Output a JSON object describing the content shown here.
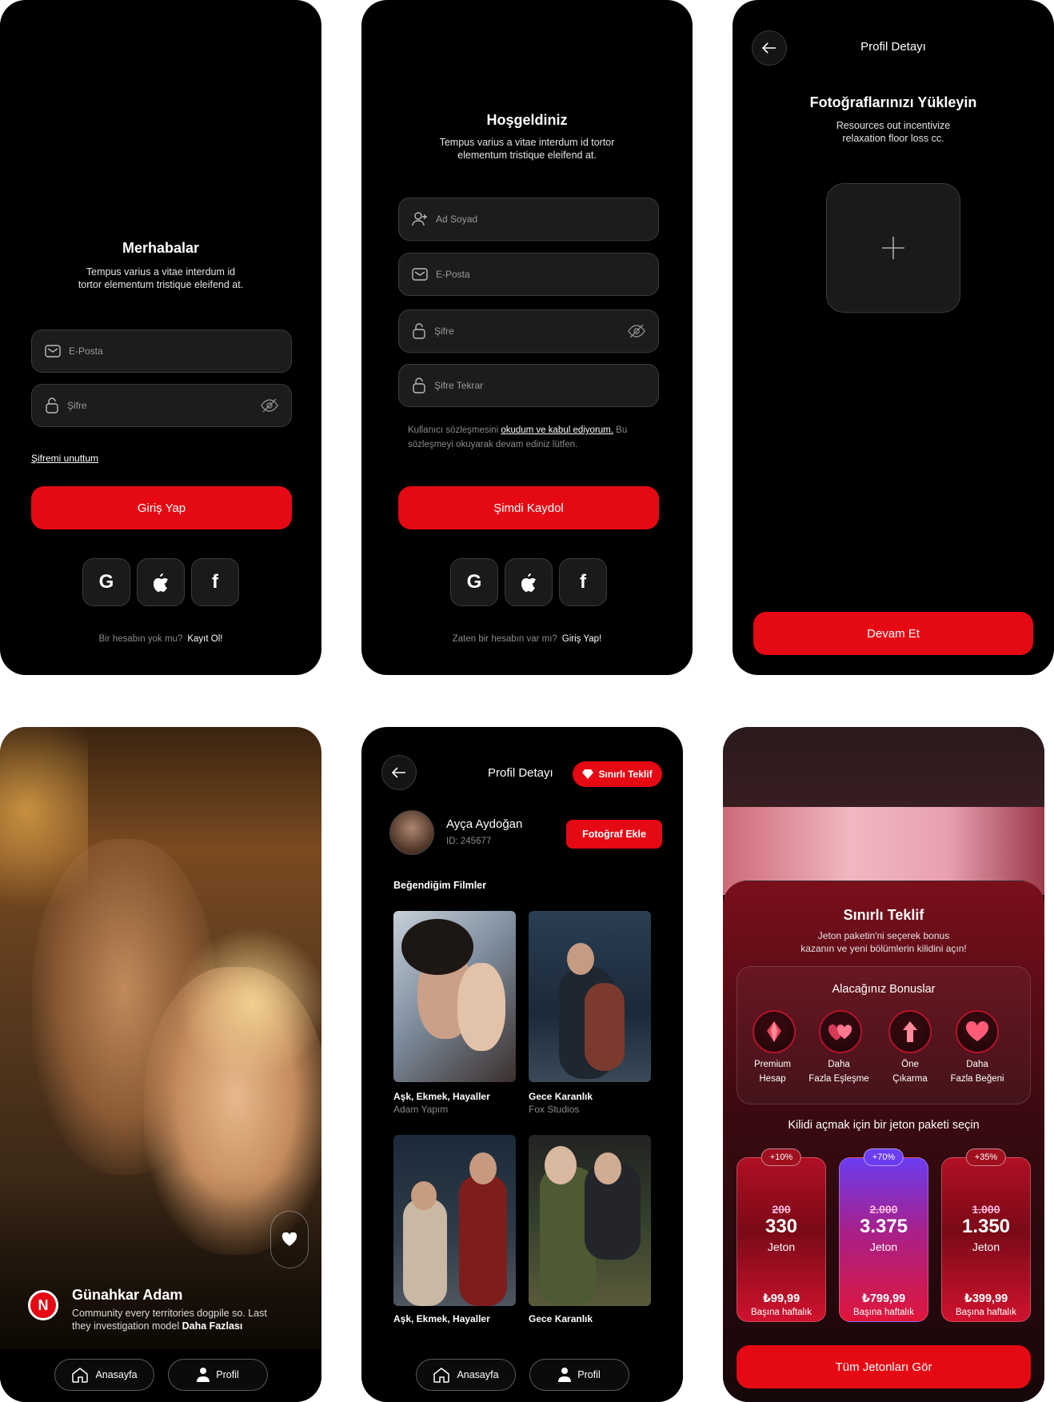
{
  "login": {
    "title": "Merhabalar",
    "subtitle_1": "Tempus varius a vitae interdum id",
    "subtitle_2": "tortor elementum tristique eleifend at.",
    "email_placeholder": "E-Posta",
    "password_placeholder": "Şifre",
    "forgot": "Şifremi unuttum",
    "submit": "Giriş Yap",
    "no_account": "Bir hesabın yok mu?",
    "signup_link": "Kayıt Ol!"
  },
  "register": {
    "title": "Hoşgeldiniz",
    "subtitle_1": "Tempus varius a vitae interdum id tortor",
    "subtitle_2": "elementum tristique eleifend at.",
    "name_placeholder": "Ad Soyad",
    "email_placeholder": "E-Posta",
    "password_placeholder": "Şifre",
    "password_repeat_placeholder": "Şifre Tekrar",
    "terms_pre": "Kullanıcı sözleşmesini ",
    "terms_link": "okudum ve kabul ediyorum.",
    "terms_post": " Bu",
    "terms_line2": "sözleşmeyi okuyarak devam ediniz lütfen.",
    "submit": "Şimdi Kaydol",
    "have_account": "Zaten bir hesabın var mı?",
    "login_link": "Giriş Yap!"
  },
  "upload": {
    "header": "Profil Detayı",
    "title": "Fotoğraflarınızı Yükleyin",
    "subtitle_1": "Resources out incentivize",
    "subtitle_2": "relaxation floor loss cc.",
    "continue": "Devam Et"
  },
  "feed": {
    "logo_letter": "N",
    "movie_title": "Günahkar Adam",
    "desc_1": "Community every territories dogpile so. Last",
    "desc_2": "they investigation model",
    "more": "Daha Fazlası",
    "nav_home": "Anasayfa",
    "nav_profile": "Profil"
  },
  "profile": {
    "header": "Profil Detayı",
    "offer_badge": "Sınırlı Teklif",
    "name": "Ayça Aydoğan",
    "id": "ID: 245677",
    "add_photo": "Fotoğraf Ekle",
    "section": "Beğendiğim Filmler",
    "movies": [
      {
        "title": "Aşk, Ekmek, Hayaller",
        "studio": "Adam Yapım"
      },
      {
        "title": "Gece Karanlık",
        "studio": "Fox Studios"
      },
      {
        "title": "Aşk, Ekmek, Hayaller",
        "studio": ""
      },
      {
        "title": "Gece Karanlık",
        "studio": ""
      }
    ],
    "nav_home": "Anasayfa",
    "nav_profile": "Profil"
  },
  "offer": {
    "title": "Sınırlı Teklif",
    "subtitle_1": "Jeton paketin'ni seçerek bonus",
    "subtitle_2": "kazanın ve yeni bölümlerin kilidini açın!",
    "bonus_title": "Alacağınız Bonuslar",
    "bonuses": [
      {
        "l1": "Premium",
        "l2": "Hesap"
      },
      {
        "l1": "Daha",
        "l2": "Fazla Eşleşme"
      },
      {
        "l1": "Öne",
        "l2": "Çıkarma"
      },
      {
        "l1": "Daha",
        "l2": "Fazla Beğeni"
      }
    ],
    "choose": "Kilidi açmak için bir jeton paketi seçin",
    "packs": [
      {
        "badge": "+10%",
        "old": "200",
        "new": "330",
        "unit": "Jeton",
        "price": "₺99,99",
        "per": "Başına haftalık"
      },
      {
        "badge": "+70%",
        "old": "2.000",
        "new": "3.375",
        "unit": "Jeton",
        "price": "₺799,99",
        "per": "Başına haftalık"
      },
      {
        "badge": "+35%",
        "old": "1.000",
        "new": "1.350",
        "unit": "Jeton",
        "price": "₺399,99",
        "per": "Başına haftalık"
      }
    ],
    "all": "Tüm Jetonları Gör"
  },
  "colors": {
    "accent": "#e50914",
    "bg": "#000000",
    "purple": "#6b3cf0"
  }
}
